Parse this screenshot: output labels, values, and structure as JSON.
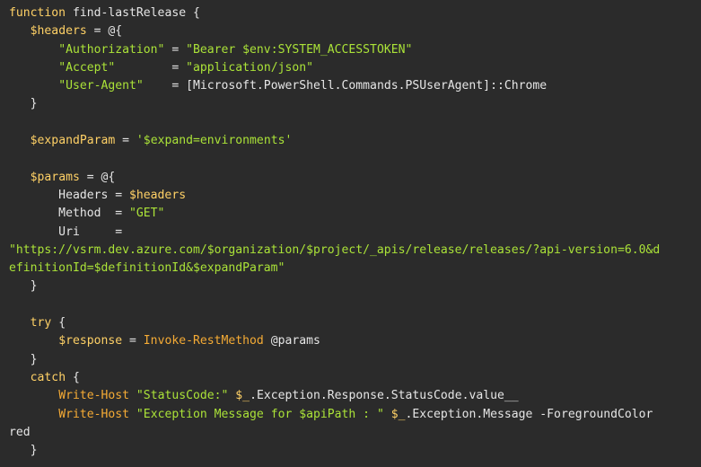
{
  "code_lines": [
    [
      {
        "t": "function",
        "c": "kw"
      },
      {
        "t": " find-lastRelease {",
        "c": "pln"
      }
    ],
    [
      {
        "t": "   ",
        "c": "pln"
      },
      {
        "t": "$headers",
        "c": "var"
      },
      {
        "t": " = @{",
        "c": "pln"
      }
    ],
    [
      {
        "t": "       ",
        "c": "pln"
      },
      {
        "t": "\"Authorization\"",
        "c": "str"
      },
      {
        "t": " = ",
        "c": "pln"
      },
      {
        "t": "\"Bearer $env:SYSTEM_ACCESSTOKEN\"",
        "c": "str"
      }
    ],
    [
      {
        "t": "       ",
        "c": "pln"
      },
      {
        "t": "\"Accept\"",
        "c": "str"
      },
      {
        "t": "        = ",
        "c": "pln"
      },
      {
        "t": "\"application/json\"",
        "c": "str"
      }
    ],
    [
      {
        "t": "       ",
        "c": "pln"
      },
      {
        "t": "\"User-Agent\"",
        "c": "str"
      },
      {
        "t": "    = [Microsoft.PowerShell.Commands.PSUserAgent]::Chrome",
        "c": "pln"
      }
    ],
    [
      {
        "t": "   }",
        "c": "pln"
      }
    ],
    [
      {
        "t": "",
        "c": "pln"
      }
    ],
    [
      {
        "t": "   ",
        "c": "pln"
      },
      {
        "t": "$expandParam",
        "c": "var"
      },
      {
        "t": " = ",
        "c": "pln"
      },
      {
        "t": "'$expand=environments'",
        "c": "str"
      }
    ],
    [
      {
        "t": "",
        "c": "pln"
      }
    ],
    [
      {
        "t": "   ",
        "c": "pln"
      },
      {
        "t": "$params",
        "c": "var"
      },
      {
        "t": " = @{",
        "c": "pln"
      }
    ],
    [
      {
        "t": "       Headers = ",
        "c": "pln"
      },
      {
        "t": "$headers",
        "c": "var"
      }
    ],
    [
      {
        "t": "       Method  = ",
        "c": "pln"
      },
      {
        "t": "\"GET\"",
        "c": "str"
      }
    ],
    [
      {
        "t": "       Uri     =",
        "c": "pln"
      }
    ],
    [
      {
        "t": "\"https://vsrm.dev.azure.com/$organization/$project/_apis/release/releases/?api-version=6.0&d",
        "c": "str"
      }
    ],
    [
      {
        "t": "efinitionId=$definitionId&$expandParam\"",
        "c": "str"
      }
    ],
    [
      {
        "t": "   }",
        "c": "pln"
      }
    ],
    [
      {
        "t": "",
        "c": "pln"
      }
    ],
    [
      {
        "t": "   ",
        "c": "pln"
      },
      {
        "t": "try",
        "c": "kw"
      },
      {
        "t": " {",
        "c": "pln"
      }
    ],
    [
      {
        "t": "       ",
        "c": "pln"
      },
      {
        "t": "$response",
        "c": "var"
      },
      {
        "t": " = ",
        "c": "pln"
      },
      {
        "t": "Invoke-RestMethod",
        "c": "fn"
      },
      {
        "t": " @params",
        "c": "pln"
      }
    ],
    [
      {
        "t": "   }",
        "c": "pln"
      }
    ],
    [
      {
        "t": "   ",
        "c": "pln"
      },
      {
        "t": "catch",
        "c": "kw"
      },
      {
        "t": " {",
        "c": "pln"
      }
    ],
    [
      {
        "t": "       ",
        "c": "pln"
      },
      {
        "t": "Write-Host",
        "c": "fn"
      },
      {
        "t": " ",
        "c": "pln"
      },
      {
        "t": "\"StatusCode:\"",
        "c": "str"
      },
      {
        "t": " ",
        "c": "pln"
      },
      {
        "t": "$_",
        "c": "var"
      },
      {
        "t": ".Exception.Response.StatusCode.value__",
        "c": "pln"
      }
    ],
    [
      {
        "t": "       ",
        "c": "pln"
      },
      {
        "t": "Write-Host",
        "c": "fn"
      },
      {
        "t": " ",
        "c": "pln"
      },
      {
        "t": "\"Exception Message for $apiPath : \"",
        "c": "str"
      },
      {
        "t": " ",
        "c": "pln"
      },
      {
        "t": "$_",
        "c": "var"
      },
      {
        "t": ".Exception.Message -ForegroundColor",
        "c": "pln"
      }
    ],
    [
      {
        "t": "red",
        "c": "pln"
      }
    ],
    [
      {
        "t": "   }",
        "c": "pln"
      }
    ]
  ],
  "colors": {
    "background": "#2b2b2b",
    "keyword": "#ffd166",
    "string": "#abe338",
    "plain": "#e6e6e6",
    "command": "#f5ab35"
  }
}
